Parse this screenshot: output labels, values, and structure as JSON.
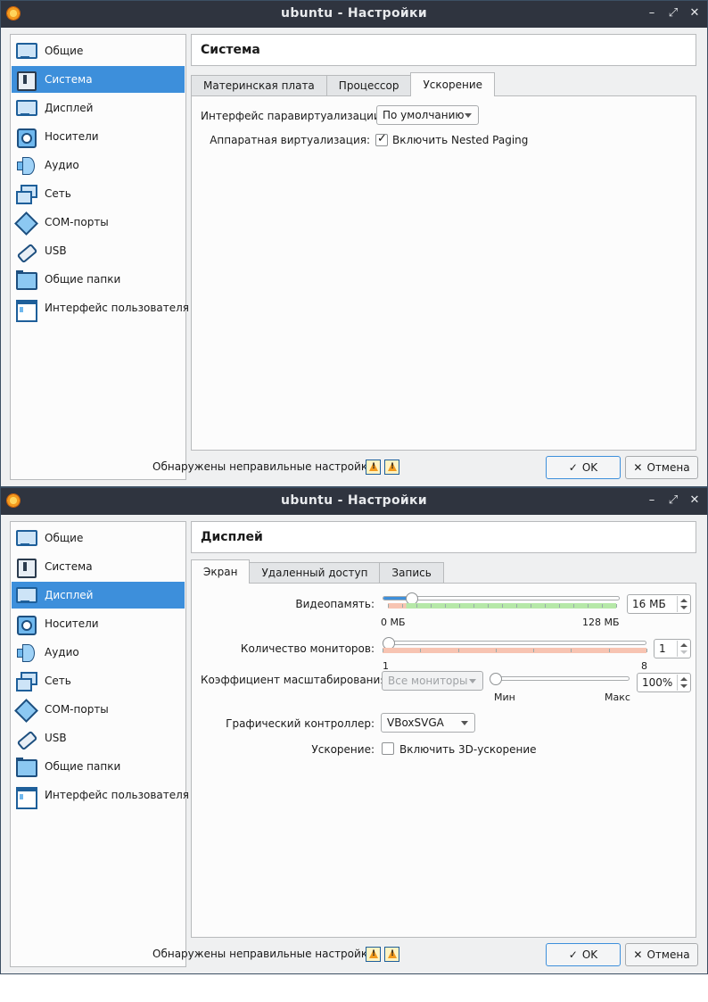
{
  "windows": [
    {
      "title": "ubuntu - Настройки",
      "controls": {
        "minimize": "–",
        "maximize": "⤢",
        "close": "✕"
      },
      "sidebar": [
        {
          "label": "Общие",
          "icon": "monitor-icon",
          "selected": false
        },
        {
          "label": "Система",
          "icon": "chip-icon",
          "selected": true
        },
        {
          "label": "Дисплей",
          "icon": "monitor-icon",
          "selected": false
        },
        {
          "label": "Носители",
          "icon": "disk-icon",
          "selected": false
        },
        {
          "label": "Аудио",
          "icon": "speaker-icon",
          "selected": false
        },
        {
          "label": "Сеть",
          "icon": "network-icon",
          "selected": false
        },
        {
          "label": "COM-порты",
          "icon": "serial-port-icon",
          "selected": false
        },
        {
          "label": "USB",
          "icon": "usb-icon",
          "selected": false
        },
        {
          "label": "Общие папки",
          "icon": "folder-icon",
          "selected": false
        },
        {
          "label": "Интерфейс пользователя",
          "icon": "window-icon",
          "selected": false
        }
      ],
      "section_title": "Система",
      "tabs": [
        {
          "label": "Материнская плата",
          "active": false
        },
        {
          "label": "Процессор",
          "active": false
        },
        {
          "label": "Ускорение",
          "active": true
        }
      ],
      "paravirt_label": "Интерфейс паравиртуализации:",
      "paravirt_value": "По умолчанию",
      "hwvirt_label": "Аппаратная виртуализация:",
      "nested_paging_label": "Включить Nested Paging",
      "nested_paging_checked": true,
      "footer_message": "Обнаружены неправильные настройки",
      "ok_label": "OK",
      "cancel_label": "Отмена"
    },
    {
      "title": "ubuntu - Настройки",
      "controls": {
        "minimize": "–",
        "maximize": "⤢",
        "close": "✕"
      },
      "sidebar": [
        {
          "label": "Общие",
          "icon": "monitor-icon",
          "selected": false
        },
        {
          "label": "Система",
          "icon": "chip-icon",
          "selected": false
        },
        {
          "label": "Дисплей",
          "icon": "monitor-icon",
          "selected": true
        },
        {
          "label": "Носители",
          "icon": "disk-icon",
          "selected": false
        },
        {
          "label": "Аудио",
          "icon": "speaker-icon",
          "selected": false
        },
        {
          "label": "Сеть",
          "icon": "network-icon",
          "selected": false
        },
        {
          "label": "COM-порты",
          "icon": "serial-port-icon",
          "selected": false
        },
        {
          "label": "USB",
          "icon": "usb-icon",
          "selected": false
        },
        {
          "label": "Общие папки",
          "icon": "folder-icon",
          "selected": false
        },
        {
          "label": "Интерфейс пользователя",
          "icon": "window-icon",
          "selected": false
        }
      ],
      "section_title": "Дисплей",
      "tabs": [
        {
          "label": "Экран",
          "active": true
        },
        {
          "label": "Удаленный доступ",
          "active": false
        },
        {
          "label": "Запись",
          "active": false
        }
      ],
      "video_memory": {
        "label": "Видеопамять:",
        "value": 16,
        "min": 0,
        "max": 128,
        "value_text": "16 МБ",
        "min_text": "0 МБ",
        "max_text": "128 МБ"
      },
      "monitors": {
        "label": "Количество мониторов:",
        "value": 1,
        "min": 1,
        "max": 8,
        "value_text": "1",
        "min_text": "1",
        "max_text": "8"
      },
      "scale": {
        "label": "Коэффициент масштабирования:",
        "combo_value": "Все мониторы",
        "value": 100,
        "value_text": "100%",
        "min_text": "Мин",
        "max_text": "Макс"
      },
      "graphics_controller": {
        "label": "Графический контроллер:",
        "value": "VBoxSVGA"
      },
      "acceleration": {
        "label": "Ускорение:",
        "checkbox_label": "Включить 3D-ускорение",
        "checked": false
      },
      "footer_message": "Обнаружены неправильные настройки",
      "ok_label": "OK",
      "cancel_label": "Отмена"
    }
  ],
  "colors": {
    "selection": "#3d8fdb",
    "titlebar": "#2f343f",
    "range_ok": "#b6e8a8",
    "range_bad": "#f7c4b2"
  }
}
